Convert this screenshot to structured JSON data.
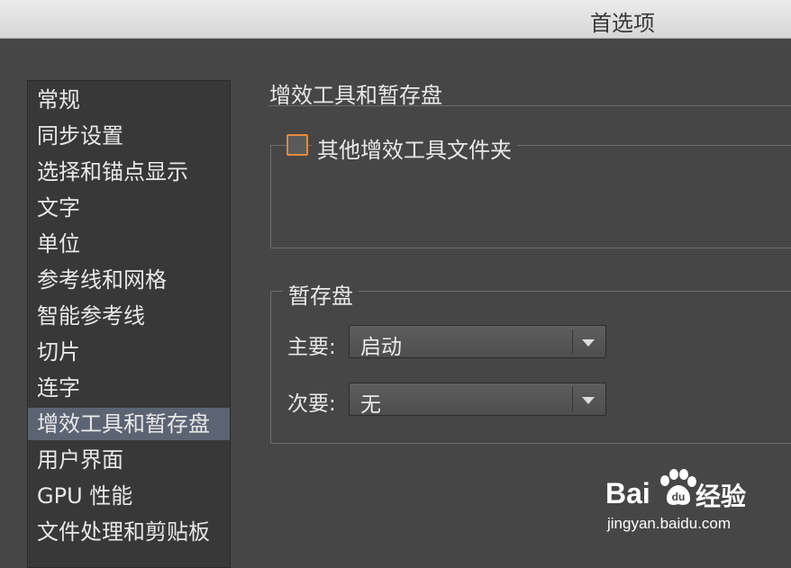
{
  "window": {
    "title": "首选项"
  },
  "sidebar": {
    "items": [
      {
        "label": "常规"
      },
      {
        "label": "同步设置"
      },
      {
        "label": "选择和锚点显示"
      },
      {
        "label": "文字"
      },
      {
        "label": "单位"
      },
      {
        "label": "参考线和网格"
      },
      {
        "label": "智能参考线"
      },
      {
        "label": "切片"
      },
      {
        "label": "连字"
      },
      {
        "label": "增效工具和暂存盘"
      },
      {
        "label": "用户界面"
      },
      {
        "label": "GPU 性能"
      },
      {
        "label": "文件处理和剪贴板"
      }
    ],
    "selected_index": 9
  },
  "main": {
    "section_title": "增效工具和暂存盘",
    "plugins_group": {
      "checkbox_label": "其他增效工具文件夹",
      "checked": false
    },
    "scratch_group": {
      "legend": "暂存盘",
      "primary": {
        "label": "主要:",
        "value": "启动"
      },
      "secondary": {
        "label": "次要:",
        "value": "无"
      }
    }
  },
  "watermark": {
    "brand": "Bai",
    "brand_suffix": "经验",
    "url": "jingyan.baidu.com"
  },
  "colors": {
    "accent_checkbox": "#e8893a",
    "selected_item": "#5c6474"
  }
}
